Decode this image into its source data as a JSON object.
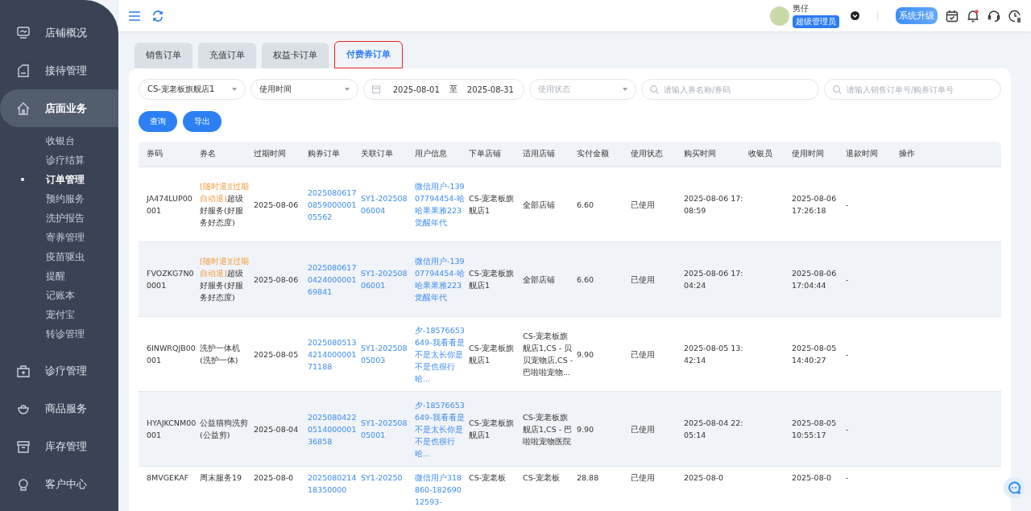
{
  "sidebar": {
    "items": [
      {
        "label": "店铺概况",
        "selected": false
      },
      {
        "label": "接待管理",
        "selected": false
      },
      {
        "label": "店面业务",
        "selected": true,
        "children": [
          {
            "label": "收银台",
            "selected": false
          },
          {
            "label": "诊疗结算",
            "selected": false
          },
          {
            "label": "订单管理",
            "selected": true
          },
          {
            "label": "预约服务",
            "selected": false
          },
          {
            "label": "洗护报告",
            "selected": false
          },
          {
            "label": "寄养管理",
            "selected": false
          },
          {
            "label": "疫苗驱虫",
            "selected": false
          },
          {
            "label": "提醒",
            "selected": false
          },
          {
            "label": "记账本",
            "selected": false
          },
          {
            "label": "宠付宝",
            "selected": false
          },
          {
            "label": "转诊管理",
            "selected": false
          }
        ]
      },
      {
        "label": "诊疗管理",
        "selected": false
      },
      {
        "label": "商品服务",
        "selected": false
      },
      {
        "label": "库存管理",
        "selected": false
      },
      {
        "label": "客户中心",
        "selected": false
      }
    ]
  },
  "header": {
    "user_name": "男仔",
    "role": "超级管理员",
    "upgrade_button": "系统升级",
    "has_notification": true
  },
  "tabs": [
    {
      "label": "销售订单",
      "selected": false
    },
    {
      "label": "充值订单",
      "selected": false
    },
    {
      "label": "权益卡订单",
      "selected": false
    },
    {
      "label": "付费券订单",
      "selected": true
    }
  ],
  "filters": {
    "store": "CS-宠老板旗舰店1",
    "time_type": "使用时间",
    "date_start": "2025-08-01",
    "date_separator": "至",
    "date_end": "2025-08-31",
    "status_placeholder": "使用状态",
    "coupon_search_placeholder": "请输入券名称/券码",
    "order_search_placeholder": "请输入销售订单号/购券订单号"
  },
  "buttons": [
    "查询",
    "导出"
  ],
  "table": {
    "columns": [
      "券码",
      "券名",
      "过期时间",
      "购券订单",
      "关联订单",
      "用户信息",
      "下单店铺",
      "适用店铺",
      "实付金额",
      "使用状态",
      "购买时间",
      "收银员",
      "使用时间",
      "退款时间",
      "操作"
    ],
    "rows": [
      {
        "code": "JA474LUP00001",
        "name_tag": "[随时退][过期自动退]",
        "name": "超级好服务(好服务好态度)",
        "expiry": "2025-08-06",
        "purchase_order": "2025080617085900000105562",
        "linked_order": "SY1-20250806004",
        "user_info": "微信用户-13907794454-哈哈果果雅223觉醒年代",
        "order_store": "CS-宠老板旗舰店1",
        "applicable_stores": "全部店铺",
        "paid_amount": "6.60",
        "status": "已使用",
        "purchase_time": "2025-08-06 17:08:59",
        "use_time": "2025-08-06 17:26:18",
        "refund_time": "-"
      },
      {
        "code": "FVOZKG7N00001",
        "name_tag": "[随时退][过期自动退]",
        "name": "超级好服务(好服务好态度)",
        "expiry": "2025-08-06",
        "purchase_order": "2025080617042400000169841",
        "linked_order": "SY1-20250806001",
        "user_info": "微信用户-13907794454-哈哈果果雅223觉醒年代",
        "order_store": "CS-宠老板旗舰店1",
        "applicable_stores": "全部店铺",
        "paid_amount": "6.60",
        "status": "已使用",
        "purchase_time": "2025-08-06 17:04:24",
        "use_time": "2025-08-06 17:04:44",
        "refund_time": "-"
      },
      {
        "code": "6INWRQJB00001",
        "name": "洗护一体机(洗护一体)",
        "expiry": "2025-08-05",
        "purchase_order": "2025080513421400000171188",
        "linked_order": "SY1-20250805003",
        "user_info": "夕-18576653649-我看看是不是太长你是不是也很行哈...",
        "order_store": "CS-宠老板旗舰店1",
        "applicable_stores": "CS-宠老板旗舰店1,CS - 贝贝宠物店,CS - 巴啦啦宠物...",
        "paid_amount": "9.90",
        "status": "已使用",
        "purchase_time": "2025-08-05 13:42:14",
        "use_time": "2025-08-05 14:40:27",
        "refund_time": "-"
      },
      {
        "code": "HYAJKCNM00001",
        "name": "公益猫狗洗剪(公益剪)",
        "expiry": "2025-08-04",
        "purchase_order": "2025080422051400000136858",
        "linked_order": "SY1-20250805001",
        "user_info": "夕-18576653649-我看看是不是太长你是不是也很行哈...",
        "order_store": "CS-宠老板旗舰店1",
        "applicable_stores": "CS-宠老板旗舰店1,CS - 巴啦啦宠物医院",
        "paid_amount": "9.90",
        "status": "已使用",
        "purchase_time": "2025-08-04 22:05:14",
        "use_time": "2025-08-05 10:55:17",
        "refund_time": "-"
      },
      {
        "code": "8MVGEKAF",
        "name": "周末服务19",
        "expiry": "2025-08-0",
        "purchase_order": "202508021418350000",
        "linked_order": "SY1-20250",
        "user_info": "微信用户318860-18269012593-",
        "order_store": "CS-宠老板",
        "applicable_stores": "CS-宠老板",
        "paid_amount": "28.88",
        "status": "已使用",
        "purchase_time": "2025-08-0",
        "use_time": "2025-08-0",
        "refund_time": "-"
      }
    ]
  }
}
